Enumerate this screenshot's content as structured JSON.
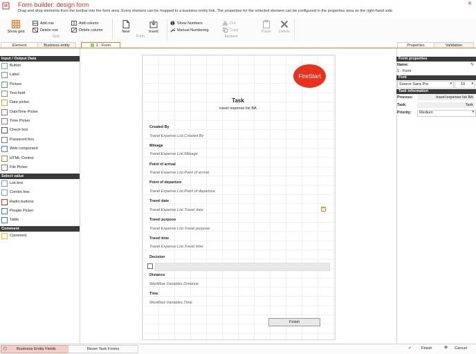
{
  "window": {
    "title": "Form builder: design form",
    "subtitle": "Drag and drop elements from the toolbar into the form area. Every element can be mapped to a business entity link. The properties for the selected element can be configured in the properties area on the right-hand side."
  },
  "ribbon": {
    "show_grid": "Show grid",
    "add_row": "Add row",
    "delete_row": "Delete row",
    "add_column": "Add column",
    "delete_column": "Delete column",
    "group_grid": "Grid",
    "new": "New",
    "insert": "Insert",
    "group_form": "Form",
    "show_numbers": "Show Numbers",
    "manual_numbering": "Manual Numbering",
    "cut": "Cut",
    "copy": "Copy",
    "paste": "Paste",
    "delete": "Delete",
    "group_element": "Element"
  },
  "tabs": {
    "element": "Element",
    "business_entity": "Business entity",
    "form": "1 - Form",
    "properties": "Properties",
    "validation": "Validation"
  },
  "toolbox": {
    "input_output": {
      "header": "Input / Output Data",
      "items": [
        "Button",
        "Label",
        "Picture",
        "Text field",
        "Date picker",
        "DateTime Picker",
        "Time Picker",
        "Check box",
        "Password box",
        "Web component",
        "HTML Control",
        "File Picker"
      ]
    },
    "select_value": {
      "header": "Select value",
      "items": [
        "List box",
        "Combo box",
        "Radio buttons",
        "People Picker",
        "Table"
      ]
    },
    "comment": {
      "header": "Comment",
      "items": [
        "Comment"
      ]
    }
  },
  "form": {
    "logo_text": "FireStart",
    "title": "Task",
    "subtitle": "travel expense list BA",
    "fields": [
      {
        "label": "Created By",
        "value": "Travel Expense List.Created By"
      },
      {
        "label": "Mileage",
        "value": "Travel Expense List.Mileage"
      },
      {
        "label": "Point of arrival",
        "value": "Travel Expense List.Point of arrival"
      },
      {
        "label": "Point of departure",
        "value": "Travel Expense List.Point of departure"
      },
      {
        "label": "Travel date",
        "value": "Travel Expense List.Travel date"
      },
      {
        "label": "Travel purpose",
        "value": "Travel Expense List.Travel purpose"
      },
      {
        "label": "Travel time",
        "value": "Travel Expense List.Travel time"
      },
      {
        "label": "Decision",
        "value": ""
      },
      {
        "label": "Distance",
        "value": "Workflow Variables.Distance"
      },
      {
        "label": "Time",
        "value": "Workflow Variables.Time"
      }
    ],
    "finish_button": "Finish"
  },
  "properties": {
    "form_properties_header": "Form properties",
    "name_label": "Name:",
    "name_value": "1 - Form",
    "font_header": "Font",
    "font_family": "Source Sans Pro",
    "font_size": "10",
    "task_info_header": "Task information",
    "process_label": "Process:",
    "process_value": "travel expense list BA",
    "task_label": "Task:",
    "task_value": "Task",
    "priority_label": "Priority:",
    "priority_value": "Medium"
  },
  "bottom": {
    "business_entity_fields": "Business Entity Fields",
    "reset_task_forms": "Reset Task Forms",
    "finish": "Finish",
    "cancel": "Cancel"
  },
  "colors": {
    "accent": "#e67e22",
    "title": "#c0392b",
    "logo": "#e8321e"
  }
}
